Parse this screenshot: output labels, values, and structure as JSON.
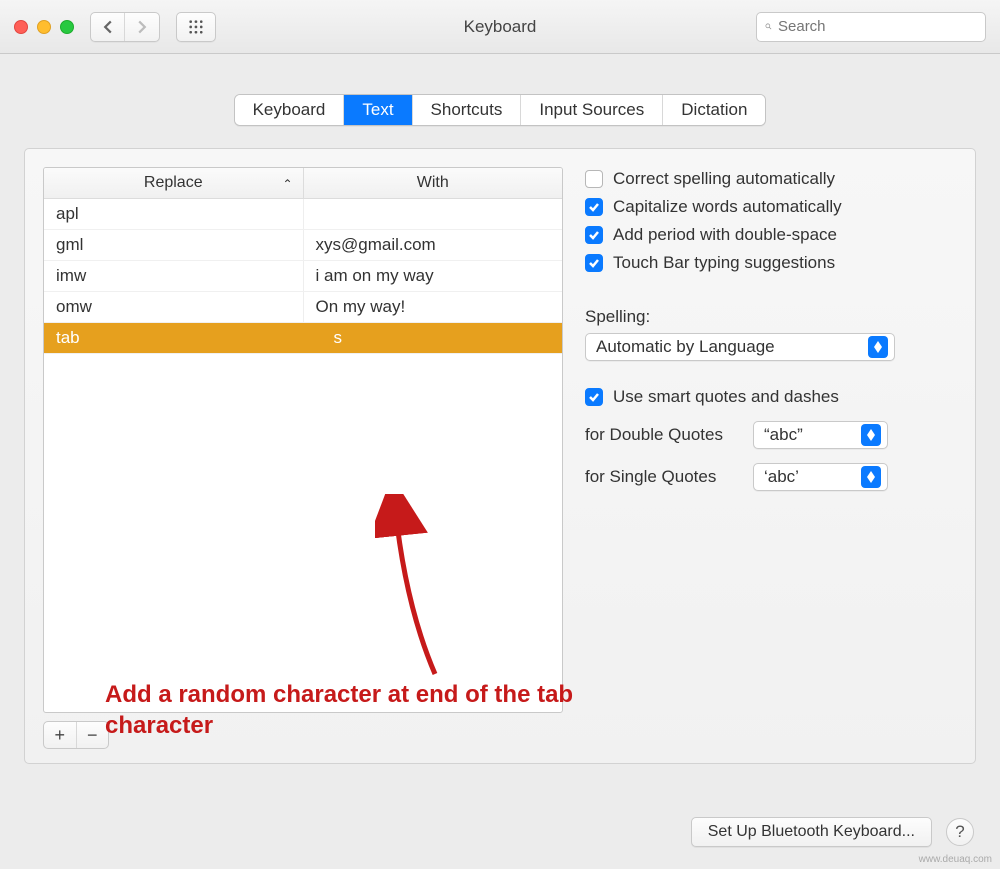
{
  "window": {
    "title": "Keyboard"
  },
  "search": {
    "placeholder": "Search"
  },
  "tabs": [
    {
      "label": "Keyboard",
      "active": false
    },
    {
      "label": "Text",
      "active": true
    },
    {
      "label": "Shortcuts",
      "active": false
    },
    {
      "label": "Input Sources",
      "active": false
    },
    {
      "label": "Dictation",
      "active": false
    }
  ],
  "table": {
    "headers": {
      "replace": "Replace",
      "with": "With"
    },
    "rows": [
      {
        "replace": "apl",
        "with": "",
        "selected": false
      },
      {
        "replace": "gml",
        "with": "xys@gmail.com",
        "selected": false
      },
      {
        "replace": "imw",
        "with": "i am on my way",
        "selected": false
      },
      {
        "replace": "omw",
        "with": "On my way!",
        "selected": false
      },
      {
        "replace": "tab",
        "with": "s",
        "selected": true
      }
    ]
  },
  "options": {
    "correct_spelling": {
      "label": "Correct spelling automatically",
      "checked": false
    },
    "capitalize": {
      "label": "Capitalize words automatically",
      "checked": true
    },
    "add_period": {
      "label": "Add period with double-space",
      "checked": true
    },
    "touch_bar": {
      "label": "Touch Bar typing suggestions",
      "checked": true
    },
    "spelling_label": "Spelling:",
    "spelling_value": "Automatic by Language",
    "smart_quotes": {
      "label": "Use smart quotes and dashes",
      "checked": true
    },
    "double_quotes_label": "for Double Quotes",
    "double_quotes_value": "“abc”",
    "single_quotes_label": "for Single Quotes",
    "single_quotes_value": "‘abc’"
  },
  "annotation": "Add a random character at end of the tab character",
  "footer": {
    "bluetooth": "Set Up Bluetooth Keyboard...",
    "help": "?"
  },
  "attribution": "www.deuaq.com"
}
